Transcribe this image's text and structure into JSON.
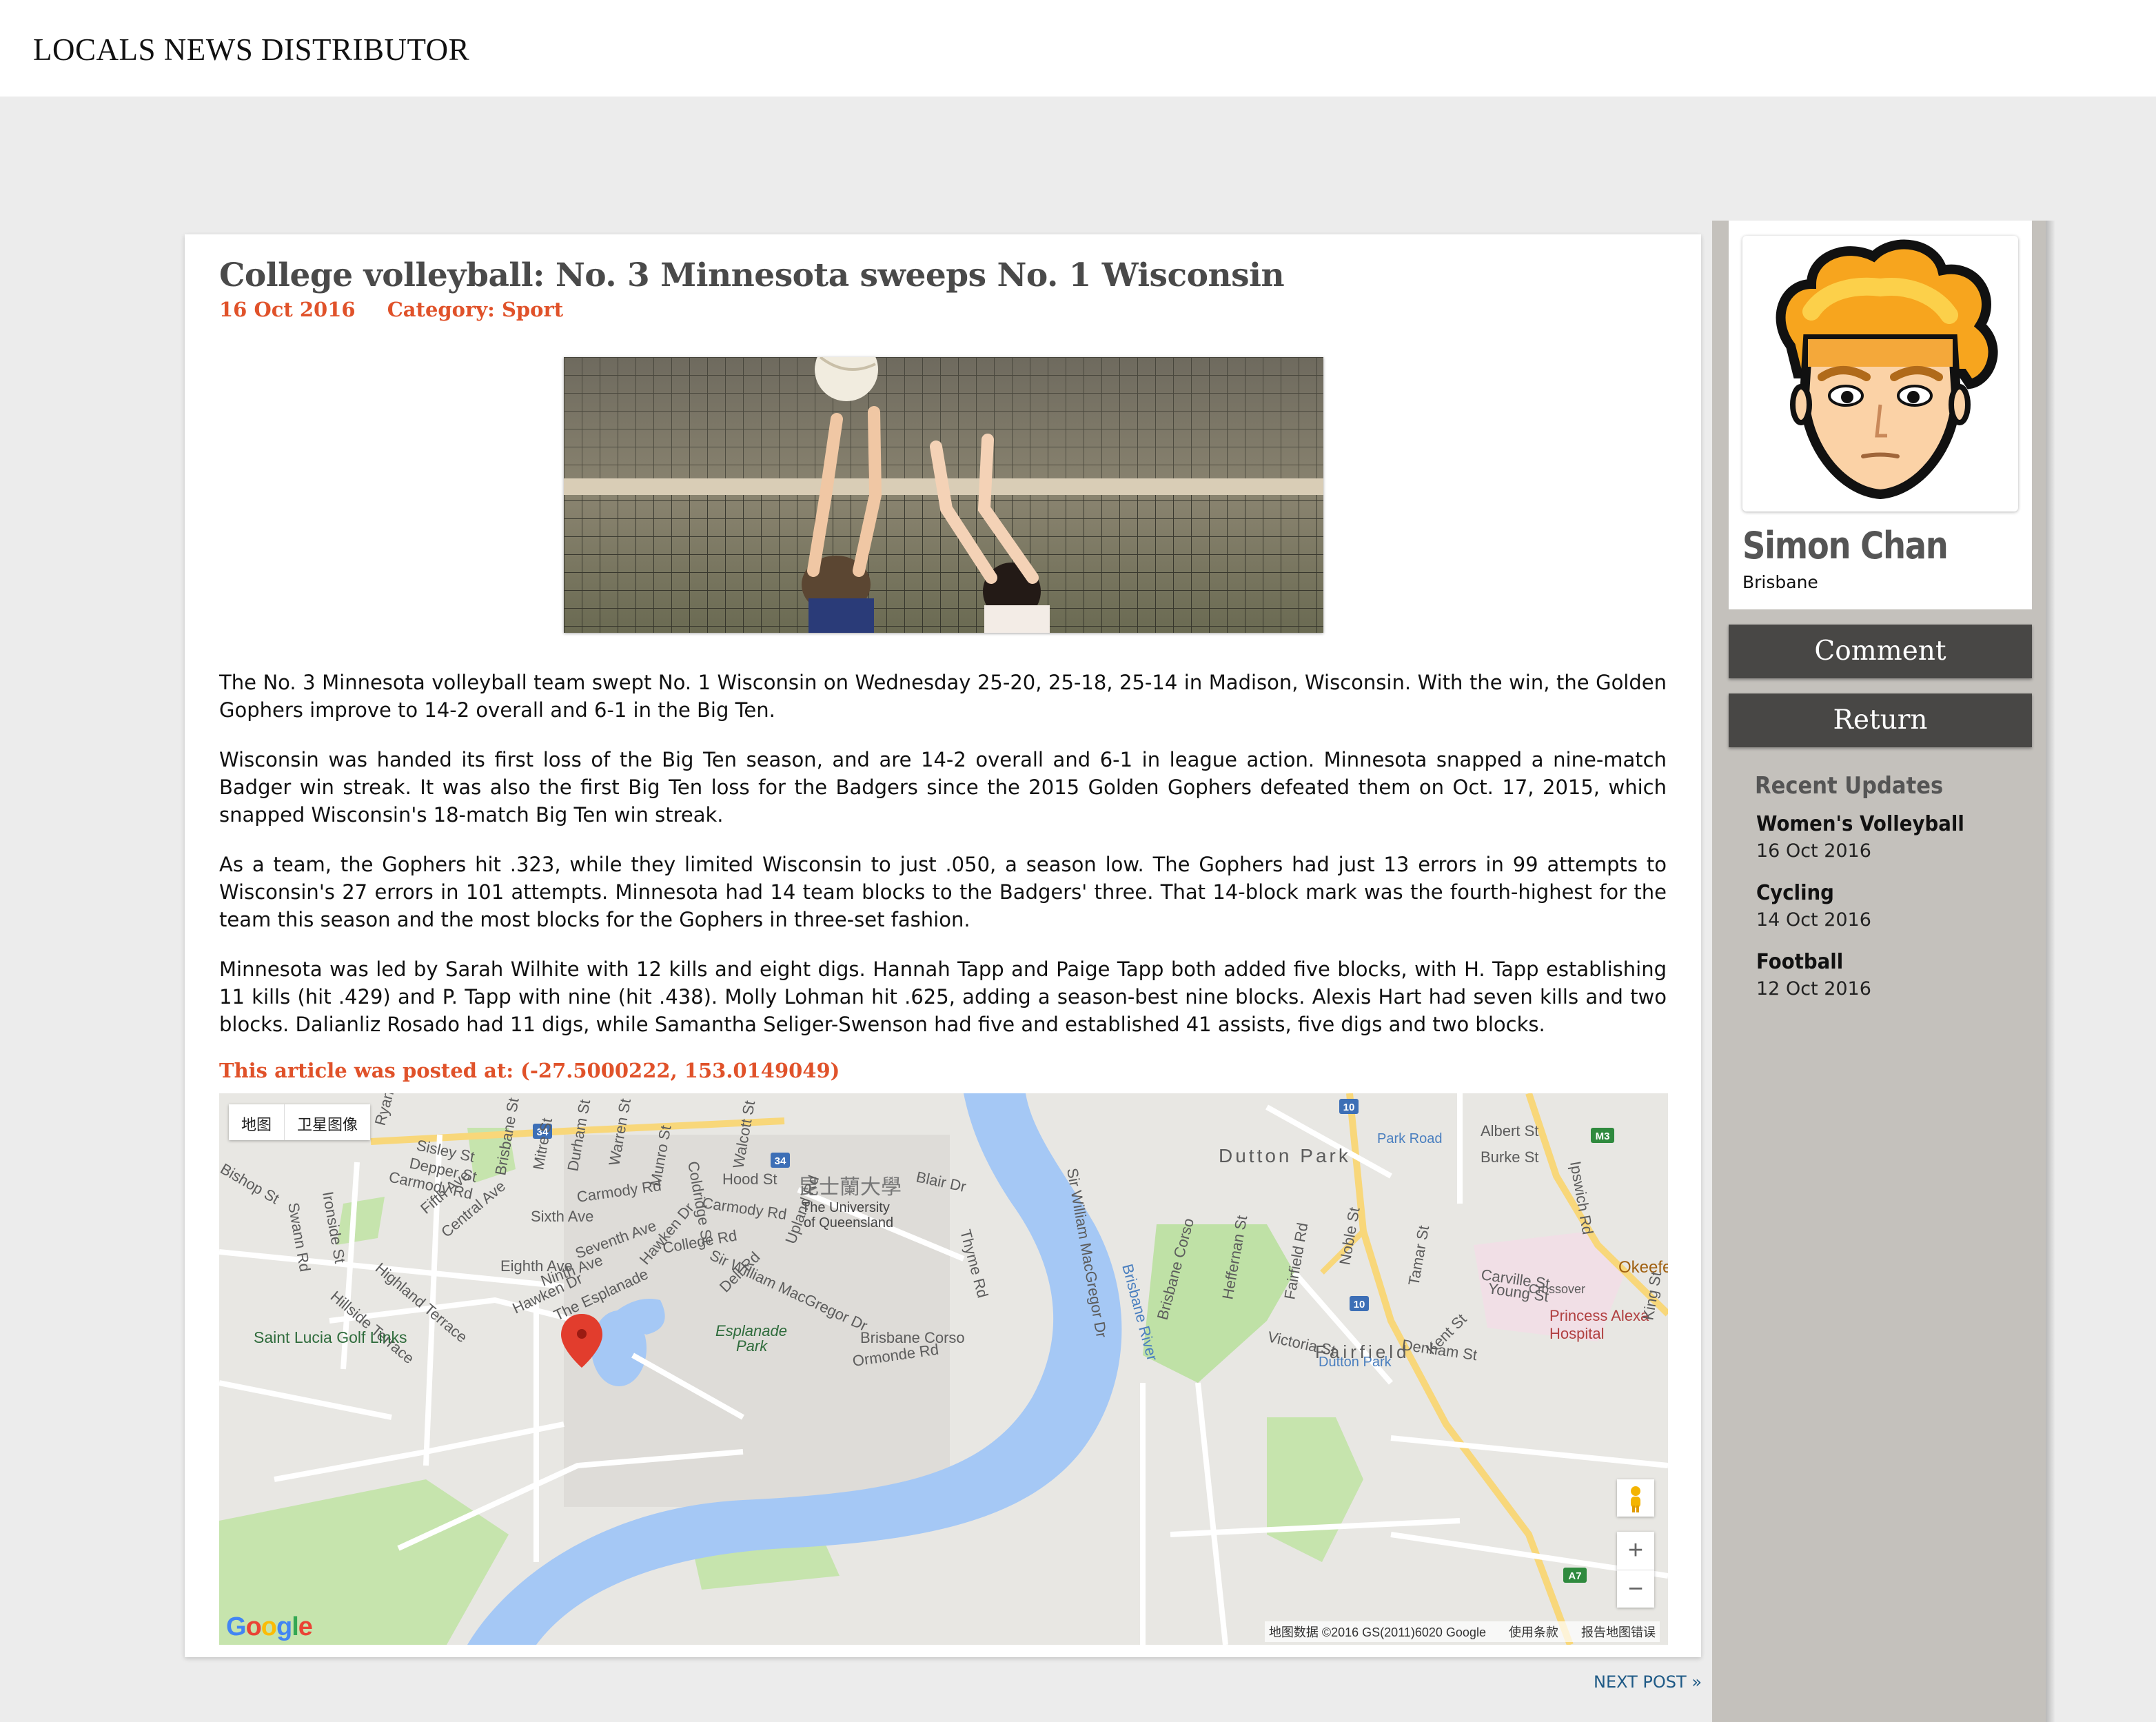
{
  "header": {
    "brand": "LOCALS NEWS DISTRIBUTOR"
  },
  "article": {
    "title": "College volleyball: No. 3 Minnesota sweeps No. 1 Wisconsin",
    "date": "16 Oct 2016",
    "category": "Category: Sport",
    "paragraphs": [
      "The No. 3 Minnesota volleyball team swept No. 1 Wisconsin on Wednesday 25-20, 25-18, 25-14 in Madison, Wisconsin. With the win, the Golden Gophers improve to 14-2 overall and 6-1 in the Big Ten.",
      "Wisconsin was handed its first loss of the Big Ten season, and are 14-2 overall and 6-1 in league action. Minnesota snapped a nine-match Badger win streak. It was also the first Big Ten loss for the Badgers since the 2015 Golden Gophers defeated them on Oct. 17, 2015, which snapped Wisconsin's 18-match Big Ten win streak.",
      "As a team, the Gophers hit .323, while they limited Wisconsin to just .050, a season low. The Gophers had just 13 errors in 99 attempts to Wisconsin's 27 errors in 101 attempts. Minnesota had 14 team blocks to the Badgers' three. That 14-block mark was the fourth-highest for the team this season and the most blocks for the Gophers in three-set fashion.",
      "Minnesota was led by Sarah Wilhite with 12 kills and eight digs. Hannah Tapp and Paige Tapp both added five blocks, with H. Tapp establishing 11 kills (hit .429) and P. Tapp with nine (hit .438). Molly Lohman hit .625, adding a season-best nine blocks. Alexis Hart had seven kills and two blocks. Dalianliz Rosado had 11 digs, while Samantha Seliger-Swenson had five and established 41 assists, five digs and two blocks."
    ],
    "posted_at": "This article was posted at: (-27.5000222, 153.0149049)",
    "next_post": "NEXT POST »"
  },
  "map": {
    "toggle": [
      "地图",
      "卫星图像"
    ],
    "zoom_in": "+",
    "zoom_out": "−",
    "google": "Google",
    "footer": [
      "地图数据 ©2016 GS(2011)6020 Google",
      "使用条款",
      "报告地图错误"
    ],
    "labels": {
      "dutton_park": "Dutton Park",
      "uq_cn": "昆士蘭大學",
      "uq1": "The University",
      "uq2": "of Queensland",
      "brisbane_river": "Brisbane River",
      "park_road": "Park Road",
      "albert_st": "Albert St",
      "burke_st": "Burke St",
      "ipswich_rd": "Ipswich Rd",
      "okeefe": "Okeefe",
      "crossover": "Crossover",
      "princess": "Princess Alexa",
      "hospital": "Hospital",
      "dutton_park_stn": "Dutton Park",
      "kent_st": "Kent St",
      "sisley_st": "Sisley St",
      "depper_st": "Depper St",
      "carmody_rd": "Carmody Rd",
      "carmody_rd2": "Carmody Rd",
      "carmody_rd3": "Carmody Rd",
      "hood_st": "Hood St",
      "sixth_ave": "Sixth Ave",
      "fifth_ave": "Fifth Ave",
      "central_ave": "Central Ave",
      "seventh_ave": "Seventh Ave",
      "eighth_ave": "Eighth Ave",
      "ninth_ave": "Ninth Ave",
      "hawken_dr": "Hawken Dr",
      "hawken_dr2": "Hawken Dr",
      "the_esplanade": "The Esplanade",
      "college_rd": "College Rd",
      "sir_william": "Sir William MacGregor Dr",
      "highland_terrace": "Highland Terrace",
      "hillside_terrace": "Hillside Terrace",
      "saint_lucia": "Saint Lucia Golf Links",
      "esplanade_park1": "Esplanade",
      "esplanade_park2": "Park",
      "brisbane_corso": "Brisbane Corso",
      "brisbane_corso2": "Brisbane Corso",
      "victoria_st": "Victoria St",
      "fairfield": "Fairfield",
      "denham_st": "Denham St",
      "carville_st": "Carville St",
      "young_st": "Young St",
      "ormonde_rd": "Ormonde Rd",
      "blair_dr": "Blair Dr",
      "bishop_st": "Bishop St",
      "swann_rd": "Swann Rd",
      "ironside_st": "Ironside St",
      "ryans_rd": "Ryans Rd",
      "brisbane_st": "Brisbane St",
      "mitre_st": "Mitre St",
      "durham_st": "Durham St",
      "warren_st": "Warren St",
      "munro_st": "Munro St",
      "coldridge_st": "Coldridge St",
      "walcott_st": "Walcott St",
      "upland_rd": "Upland Rd",
      "dell_rd": "Dell Rd",
      "thyme_rd": "Thyme Rd",
      "heffernan_st": "Heffernan St",
      "fairfield_rd": "Fairfield Rd",
      "noble_st": "Noble St",
      "tamar_st": "Tamar St",
      "king_st": "King St",
      "sir_william2": "Sir William MacGregor Dr",
      "road_34a": "34",
      "road_34b": "34",
      "road_10a": "10",
      "road_10b": "10",
      "m3": "M3",
      "a7": "A7"
    }
  },
  "profile": {
    "name": "Simon Chan",
    "city": "Brisbane",
    "comment_label": "Comment",
    "return_label": "Return"
  },
  "recent": {
    "title": "Recent Updates",
    "items": [
      {
        "title": "Women's Volleyball",
        "date": "16 Oct 2016"
      },
      {
        "title": "Cycling",
        "date": "14 Oct 2016"
      },
      {
        "title": "Football",
        "date": "12 Oct 2016"
      }
    ]
  },
  "colors": {
    "accent": "#e0522a",
    "link": "#1f5a86",
    "sidebar": "#c4c1bc",
    "button": "#484745",
    "river": "#a5c8f5"
  }
}
